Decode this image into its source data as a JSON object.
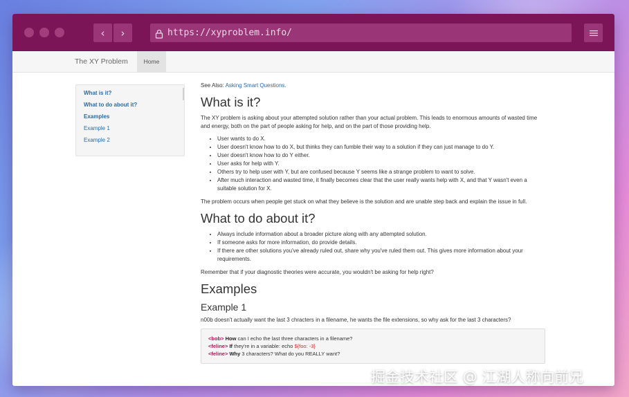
{
  "browser": {
    "url": "https://xyproblem.info/",
    "back_glyph": "‹",
    "forward_glyph": "›",
    "accent_color": "#7b1558"
  },
  "site_nav": {
    "brand": "The XY Problem",
    "home_label": "Home"
  },
  "toc": {
    "items": [
      {
        "label": "What is it?",
        "bold": true
      },
      {
        "label": "What to do about it?",
        "bold": true
      },
      {
        "label": "Examples",
        "bold": true
      },
      {
        "label": "Example 1",
        "bold": false
      },
      {
        "label": "Example 2",
        "bold": false
      }
    ]
  },
  "article": {
    "see_also_prefix": "See Also:",
    "see_also_link": "Asking Smart Questions",
    "see_also_suffix": ".",
    "section1": {
      "heading": "What is it?",
      "intro": "The XY problem is asking about your attempted solution rather than your actual problem. This leads to enormous amounts of wasted time and energy, both on the part of people asking for help, and on the part of those providing help.",
      "bullets": [
        "User wants to do X.",
        "User doesn't know how to do X, but thinks they can fumble their way to a solution if they can just manage to do Y.",
        "User doesn't know how to do Y either.",
        "User asks for help with Y.",
        "Others try to help user with Y, but are confused because Y seems like a strange problem to want to solve.",
        "After much interaction and wasted time, it finally becomes clear that the user really wants help with X, and that Y wasn't even a suitable solution for X."
      ],
      "outro": "The problem occurs when people get stuck on what they believe is the solution and are unable step back and explain the issue in full."
    },
    "section2": {
      "heading": "What to do about it?",
      "bullets": [
        "Always include information about a broader picture along with any attempted solution.",
        "If someone asks for more information, do provide details.",
        "If there are other solutions you've already ruled out, share why you've ruled them out. This gives more information about your requirements."
      ],
      "outro": "Remember that if your diagnostic theories were accurate, you wouldn't be asking for help right?"
    },
    "section3": {
      "heading": "Examples",
      "example1_heading": "Example 1",
      "example1_text": "n00b doesn't actually want the last 3 chracters in a filename, he wants the file extensions, so why ask for the last 3 characters?",
      "chat": [
        {
          "nick": "<bob>",
          "bold_part": "How",
          "rest": " can I echo the last three characters in a filename?",
          "hl": ""
        },
        {
          "nick": "<feline>",
          "bold_part": "If",
          "rest": " they're in a variable: echo ",
          "hl": "${foo: -3}"
        },
        {
          "nick": "<feline>",
          "bold_part": "Why",
          "rest": " 3 characters? What do you REALLY want?",
          "hl": ""
        }
      ]
    }
  },
  "watermark": "掘金技术社区 @ 江湖人称向前兄"
}
